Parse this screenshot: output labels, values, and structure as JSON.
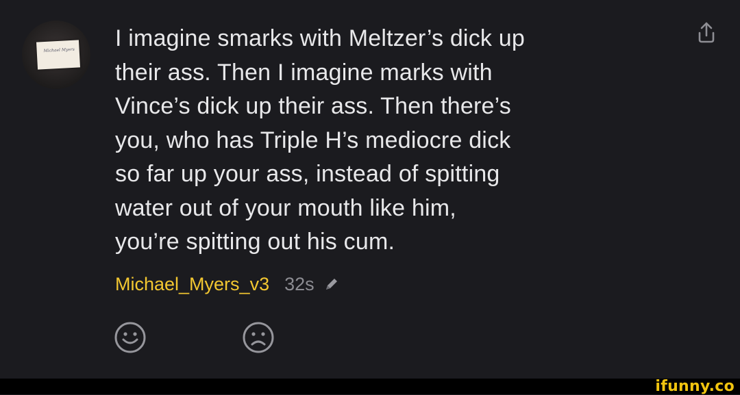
{
  "comment": {
    "lines": [
      "I imagine smarks with Meltzer’s dick up",
      "their ass. Then I imagine marks with",
      "Vince’s dick up their ass. Then there’s",
      "you, who has Triple H’s mediocre dick",
      "so far up your ass, instead of spitting",
      "water out of your mouth like him,",
      "you’re spitting out his cum."
    ],
    "username": "Michael_Myers_v3",
    "timestamp": "32s"
  },
  "icons": {
    "avatar": "avatar-photo",
    "share": "share-icon",
    "edit": "pencil-icon",
    "react_positive": "smile-icon",
    "react_negative": "frown-icon"
  },
  "watermark": {
    "text": "ifunny.co"
  },
  "colors": {
    "background": "#1b1b1f",
    "text": "#e8e8ea",
    "username": "#f3c731",
    "muted": "#8c8c92",
    "watermark": "#f1c40f"
  }
}
